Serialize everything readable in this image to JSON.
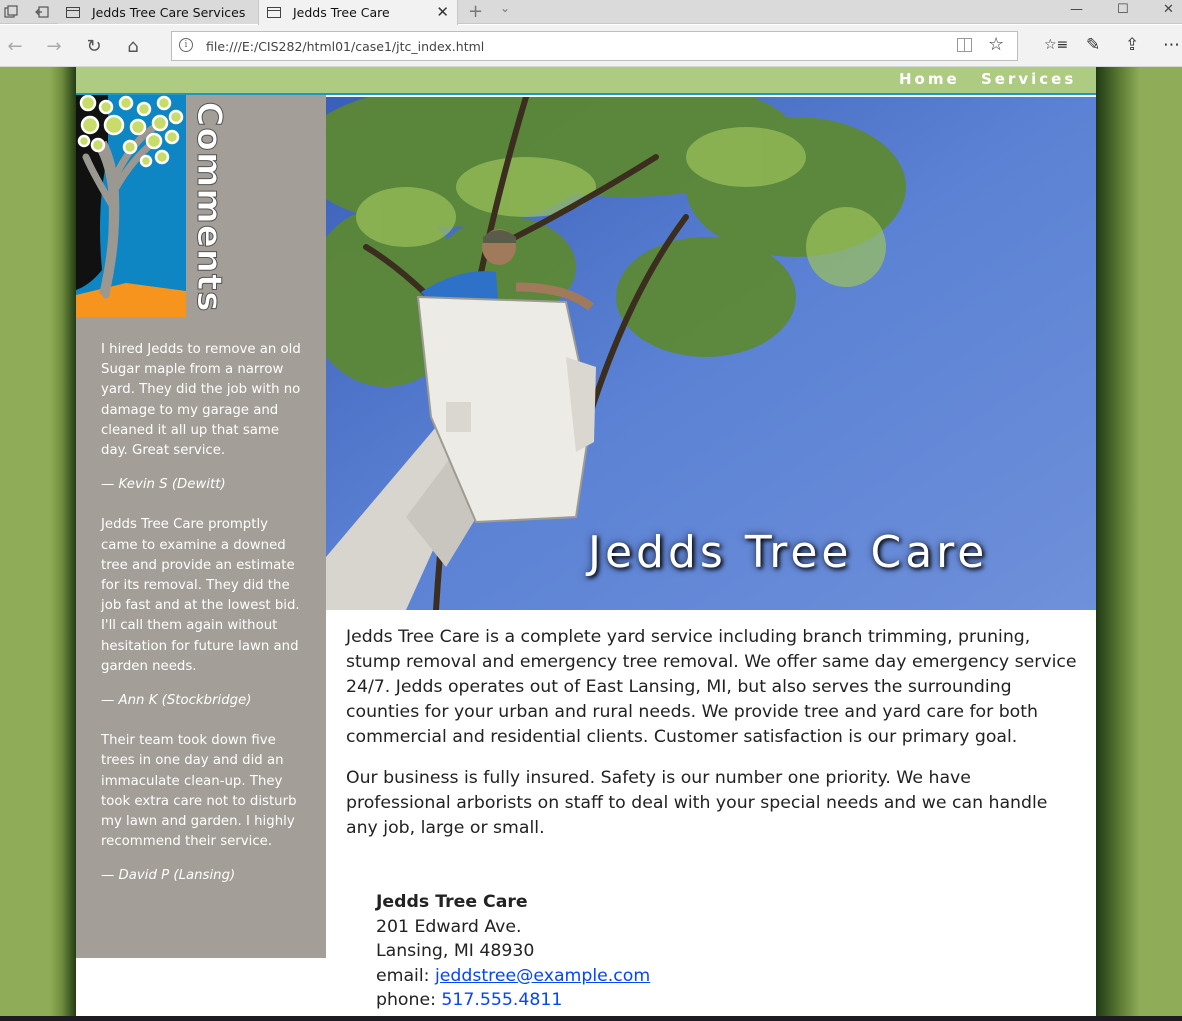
{
  "browser": {
    "tabs": [
      {
        "label": "Jedds Tree Care Services",
        "active": false
      },
      {
        "label": "Jedds Tree Care",
        "active": true
      }
    ],
    "new_tab_symbol": "+",
    "tab_menu_symbol": "⌄",
    "close_symbol": "✕",
    "window_controls": {
      "minimize": "—",
      "maximize": "☐",
      "close": "✕"
    },
    "address": "file:///E:/CIS282/html01/case1/jtc_index.html",
    "info_symbol": "i",
    "icons": {
      "back": "←",
      "forward": "→",
      "refresh": "↻",
      "home": "⌂",
      "favorite": "☆",
      "favorites_hub": "☆≡",
      "notes": "✎",
      "share": "⇪",
      "more": "⋯"
    }
  },
  "site": {
    "nav": [
      {
        "label": "Home"
      },
      {
        "label": "Services"
      }
    ],
    "sidebar_heading": "Comments",
    "testimonials": [
      {
        "quote": "I hired Jedds to remove an old Sugar maple from a narrow yard. They did the job with no damage to my garage and cleaned it all up that same day. Great service.",
        "author": "— Kevin S (Dewitt)"
      },
      {
        "quote": "Jedds Tree Care promptly came to examine a downed tree and provide an estimate for its removal. They did the job fast and at the lowest bid. I'll call them again without hesitation for future lawn and garden needs.",
        "author": "— Ann K (Stockbridge)"
      },
      {
        "quote": "Their team took down five trees in one day and did an immaculate clean-up. They took extra care not to disturb my lawn and garden. I highly recommend their service.",
        "author": "— David P (Lansing)"
      }
    ],
    "hero_title": "Jedds Tree Care",
    "paragraphs": [
      "Jedds Tree Care is a complete yard service including branch trimming, pruning, stump removal and emergency tree removal. We offer same day emergency service 24/7. Jedds operates out of East Lansing, MI, but also serves the surrounding counties for your urban and rural needs. We provide tree and yard care for both commercial and residential clients. Customer satisfaction is our primary goal.",
      "Our business is fully insured. Safety is our number one priority. We have professional arborists on staff to deal with your special needs and we can handle any job, large or small."
    ],
    "address": {
      "name": "Jedds Tree Care",
      "street": "201 Edward Ave.",
      "city": "Lansing, MI 48930",
      "email_label": "email:",
      "email": "jeddstree@example.com",
      "phone_label": "phone:",
      "phone": "517.555.4811"
    }
  },
  "colors": {
    "page_background": "#8fad58",
    "nav_bar": "#aecb82",
    "nav_accent": "#1d96c8",
    "sidebar": "#a39e97",
    "logo_blue": "#0e86c4",
    "logo_orange": "#f7941d",
    "logo_lime": "#c9dc6a",
    "link": "#0645ff"
  }
}
